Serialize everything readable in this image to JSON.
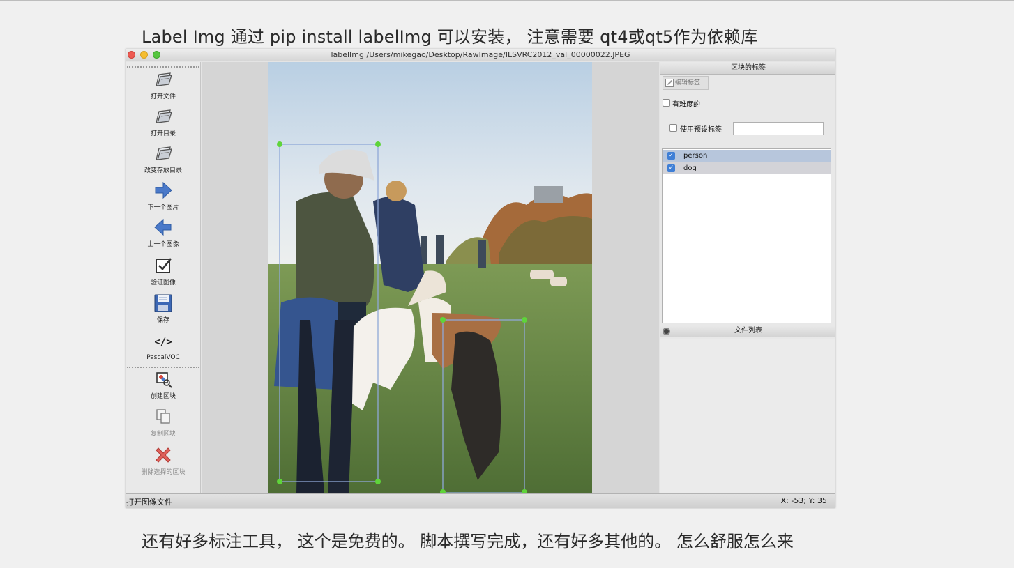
{
  "slide": {
    "heading": "Label Img   通过 pip install labelImg 可以安装， 注意需要 qt4或qt5作为依赖库",
    "caption": "还有好多标注工具， 这个是免费的。 脚本撰写完成，还有好多其他的。 怎么舒服怎么来"
  },
  "window": {
    "title": "labelImg /Users/mikegao/Desktop/RawImage/ILSVRC2012_val_00000022.JPEG"
  },
  "toolbar": {
    "items": [
      {
        "label": "打开文件",
        "icon": "folder-open-icon",
        "enabled": true
      },
      {
        "label": "打开目录",
        "icon": "folder-open-icon",
        "enabled": true
      },
      {
        "label": "改变存放目录",
        "icon": "folder-open-icon",
        "enabled": true
      },
      {
        "label": "下一个图片",
        "icon": "arrow-right-icon",
        "enabled": true
      },
      {
        "label": "上一个图像",
        "icon": "arrow-left-icon",
        "enabled": true
      },
      {
        "label": "验证图像",
        "icon": "checkbox-icon",
        "enabled": true
      },
      {
        "label": "保存",
        "icon": "floppy-disk-icon",
        "enabled": true
      },
      {
        "label": "PascalVOC",
        "icon": "code-icon",
        "glyph": "</>",
        "enabled": true
      },
      {
        "label": "创建区块",
        "icon": "create-box-icon",
        "enabled": true
      },
      {
        "label": "复制区块",
        "icon": "copy-icon",
        "enabled": false
      },
      {
        "label": "删除选择的区块",
        "icon": "delete-x-icon",
        "enabled": false
      }
    ],
    "more_glyph": "»"
  },
  "dock": {
    "title": "区块的标签",
    "edit_label": "编辑标签",
    "difficult_label": "有难度的",
    "use_default_label": "使用预设标签",
    "default_label_value": "",
    "labels": [
      {
        "name": "person",
        "checked": true
      },
      {
        "name": "dog",
        "checked": true
      }
    ],
    "file_list_title": "文件列表"
  },
  "status": {
    "left": "打开图像文件",
    "right": "X: -53; Y: 35"
  },
  "colors": {
    "box_handle": "#5fd43a",
    "box_line": "#8fa8d8",
    "selected_row": "#b7c6dc",
    "checkbox_blue": "#3f7fd6"
  }
}
